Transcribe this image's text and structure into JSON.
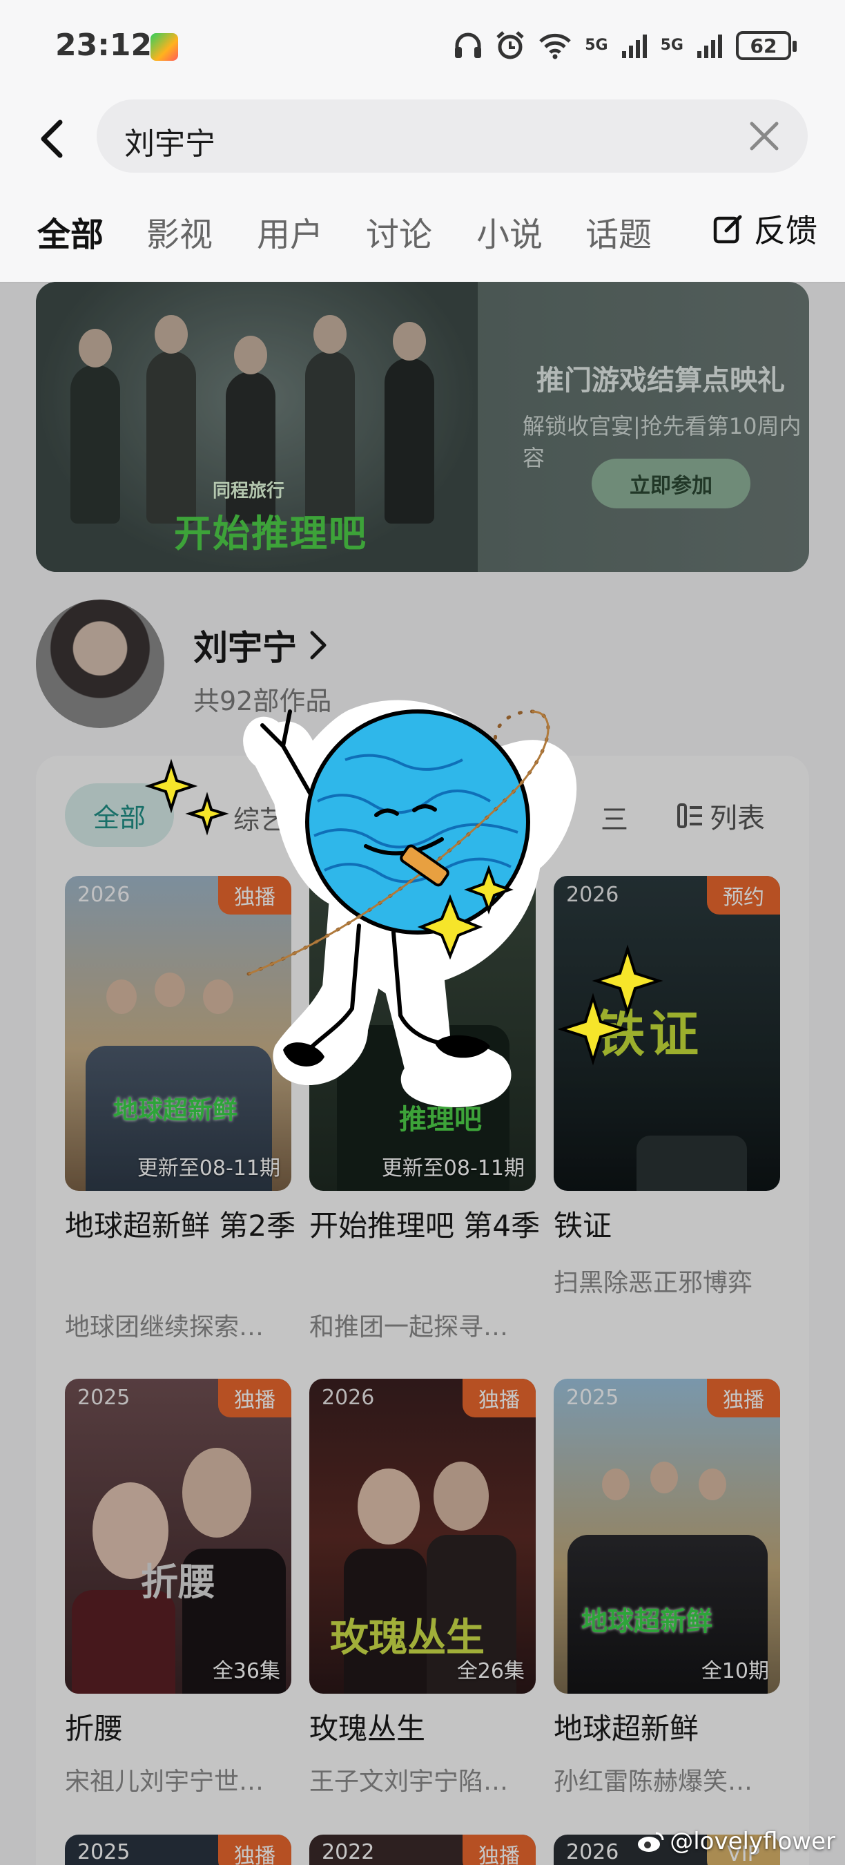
{
  "status": {
    "time": "23:12",
    "sig1": "5G",
    "sig2": "5G",
    "battery": "62",
    "wifi_label": "6"
  },
  "search": {
    "query": "刘宇宁"
  },
  "tabs": [
    {
      "label": "全部",
      "active": true
    },
    {
      "label": "影视"
    },
    {
      "label": "用户"
    },
    {
      "label": "讨论"
    },
    {
      "label": "小说"
    },
    {
      "label": "话题"
    }
  ],
  "feedback_label": "反馈",
  "banner": {
    "sponsor": "同程旅行",
    "logo_text": "开始推理吧",
    "title": "推门游戏结算点映礼",
    "subtitle": "解锁收官宴|抢先看第10周内容",
    "button": "立即参加"
  },
  "person": {
    "name": "刘宇宁",
    "count": "共92部作品"
  },
  "filters": {
    "all": "全部",
    "second": "综艺",
    "view_a": "三",
    "view_b": "列表"
  },
  "items": [
    {
      "year": "2026",
      "tag": "独播",
      "episodes": "更新至08-11期",
      "title": "地球超新鲜 第2季",
      "sub": "地球团继续探索…"
    },
    {
      "year": "",
      "tag": "",
      "episodes": "更新至08-11期",
      "title": "开始推理吧 第4季",
      "sub": "和推团一起探寻…"
    },
    {
      "year": "2026",
      "tag": "预约",
      "episodes": "",
      "title": "铁证",
      "sub": "扫黑除恶正邪博弈"
    },
    {
      "year": "2025",
      "tag": "独播",
      "episodes": "全36集",
      "title": "折腰",
      "sub": "宋祖儿刘宇宁世…"
    },
    {
      "year": "2026",
      "tag": "独播",
      "episodes": "全26集",
      "title": "玫瑰丛生",
      "sub": "王子文刘宇宁陷…"
    },
    {
      "year": "2025",
      "tag": "独播",
      "episodes": "全10期",
      "title": "地球超新鲜",
      "sub": "孙红雷陈赫爆笑…"
    }
  ],
  "partial_items": [
    {
      "year": "2025",
      "tag": "独播"
    },
    {
      "year": "2022",
      "tag": "独播"
    },
    {
      "year": "2026",
      "tag": "VIP"
    }
  ],
  "poster_art": {
    "p1": "地球超新鲜",
    "p2": "推理吧",
    "p3": "铁证",
    "p4": "折腰",
    "p5": "玫瑰丛生",
    "p6": "地球超新鲜"
  },
  "watermark": "@lovelyflower",
  "colors": {
    "accent": "#1f8f86",
    "tag": "#e9672e"
  }
}
